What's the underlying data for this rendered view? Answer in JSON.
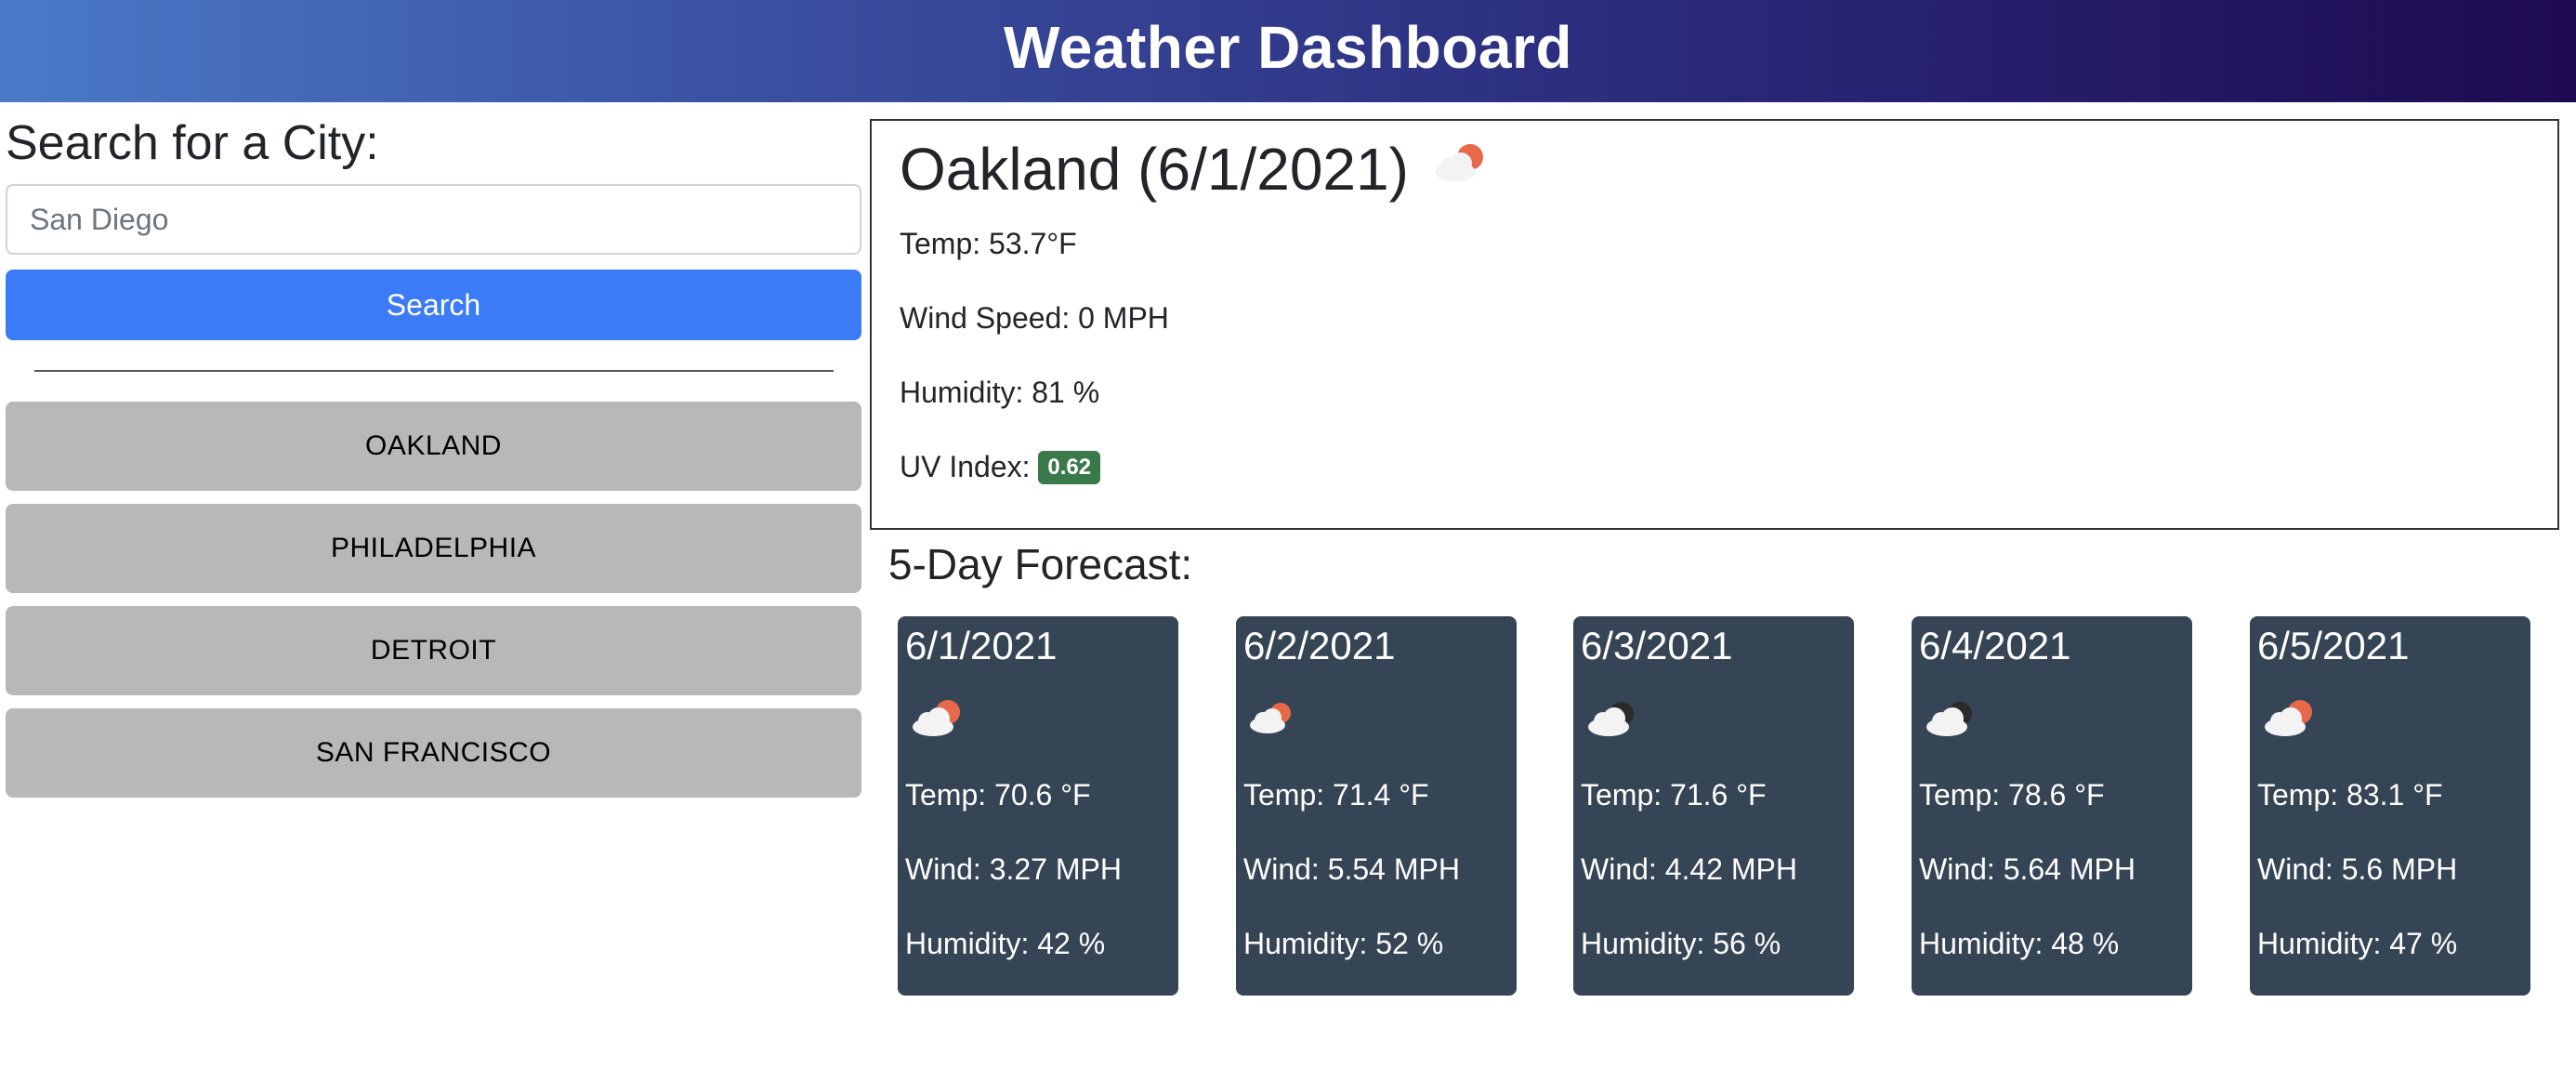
{
  "header": {
    "title": "Weather Dashboard"
  },
  "search": {
    "title": "Search for a City:",
    "input_value": "",
    "placeholder": "San Diego",
    "button_label": "Search"
  },
  "history": [
    "OAKLAND",
    "PHILADELPHIA",
    "DETROIT",
    "SAN FRANCISCO"
  ],
  "current": {
    "title": "Oakland (6/1/2021)",
    "icon": "partly-cloudy-sun-icon",
    "temp": "Temp: 53.7°F",
    "wind": "Wind Speed: 0 MPH",
    "humidity": "Humidity: 81 %",
    "uv_label": "UV Index:",
    "uv_value": "0.62",
    "uv_color": "#3a7a4a"
  },
  "forecast": {
    "title": "5-Day Forecast:",
    "days": [
      {
        "date": "6/1/2021",
        "icon": "partly-cloudy-sun-icon",
        "temp": "Temp: 70.6 °F",
        "wind": "Wind: 3.27 MPH",
        "humidity": "Humidity: 42 %"
      },
      {
        "date": "6/2/2021",
        "icon": "partly-cloudy-sun-icon",
        "temp": "Temp: 71.4 °F",
        "wind": "Wind: 5.54 MPH",
        "humidity": "Humidity: 52 %"
      },
      {
        "date": "6/3/2021",
        "icon": "cloudy-icon",
        "temp": "Temp: 71.6 °F",
        "wind": "Wind: 4.42 MPH",
        "humidity": "Humidity: 56 %"
      },
      {
        "date": "6/4/2021",
        "icon": "cloudy-icon",
        "temp": "Temp: 78.6 °F",
        "wind": "Wind: 5.64 MPH",
        "humidity": "Humidity: 48 %"
      },
      {
        "date": "6/5/2021",
        "icon": "partly-cloudy-sun-icon",
        "temp": "Temp: 83.1 °F",
        "wind": "Wind: 5.6 MPH",
        "humidity": "Humidity: 47 %"
      }
    ]
  },
  "colors": {
    "accent": "#3b7bf5",
    "card_bg": "#364556",
    "history_bg": "#b8b8b8",
    "header_start": "#4a7ac8",
    "header_end": "#1e0a50"
  }
}
